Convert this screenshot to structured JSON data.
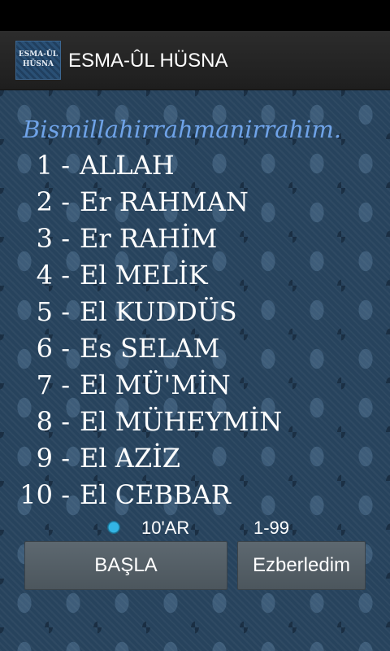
{
  "header": {
    "icon_text_line1": "ESMA-ÛL",
    "icon_text_line2": "HÜSNA",
    "title": "ESMA-ÛL HÜSNA"
  },
  "bismillah": "Bismillahirrahmanirrahim.",
  "names": [
    {
      "num": "1",
      "name": "ALLAH"
    },
    {
      "num": "2",
      "name": "Er RAHMAN"
    },
    {
      "num": "3",
      "name": "Er RAHİM"
    },
    {
      "num": "4",
      "name": "El MELİK"
    },
    {
      "num": "5",
      "name": "El KUDDÜS"
    },
    {
      "num": "6",
      "name": "Es SELAM"
    },
    {
      "num": "7",
      "name": "El MÜ'MİN"
    },
    {
      "num": "8",
      "name": "El MÜHEYMİN"
    },
    {
      "num": "9",
      "name": "El AZİZ"
    },
    {
      "num": "10",
      "name": "El CEBBAR"
    }
  ],
  "options": {
    "tens_label": "10'AR",
    "all_label": "1-99",
    "selected": "tens"
  },
  "buttons": {
    "start_label": "BAŞLA",
    "learned_label": "Ezberledim"
  },
  "colors": {
    "accent": "#33b5e5",
    "bismillah": "#6fa3e8"
  }
}
